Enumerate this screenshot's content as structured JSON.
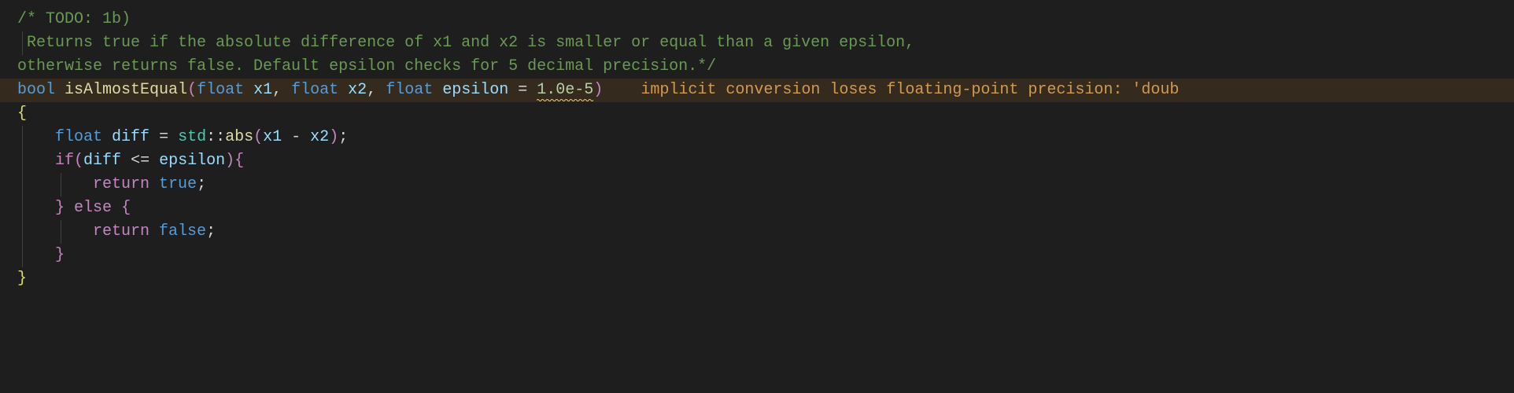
{
  "code": {
    "comment_l1_a": "/* TODO: 1b)",
    "comment_l2": " Returns true if the absolute difference of x1 and x2 is smaller or equal than a given epsilon,",
    "comment_l3": "otherwise returns false. Default epsilon checks for 5 decimal precision.*/",
    "sig": {
      "ret_type": "bool",
      "fn_name": "isAlmostEqual",
      "p1_type": "float",
      "p1_name": "x1",
      "p2_type": "float",
      "p2_name": "x2",
      "p3_type": "float",
      "p3_name": "epsilon",
      "eq": " = ",
      "default_val": "1.0e-5"
    },
    "warning_text": "implicit conversion loses floating-point precision: 'doub",
    "body": {
      "diff_type": "float",
      "diff_name": "diff",
      "assign": " = ",
      "ns": "std",
      "abs_fn": "abs",
      "abs_arg1": "x1",
      "abs_op": " - ",
      "abs_arg2": "x2",
      "if_kw": "if",
      "cond_lhs": "diff",
      "cond_op": " <= ",
      "cond_rhs": "epsilon",
      "return_kw1": "return",
      "true_lit": "true",
      "else_kw": "else",
      "return_kw2": "return",
      "false_lit": "false"
    },
    "punct": {
      "open_paren": "(",
      "close_paren": ")",
      "open_brace": "{",
      "close_brace": "}",
      "comma_sp": ", ",
      "semi": ";",
      "dcolon": "::"
    }
  }
}
